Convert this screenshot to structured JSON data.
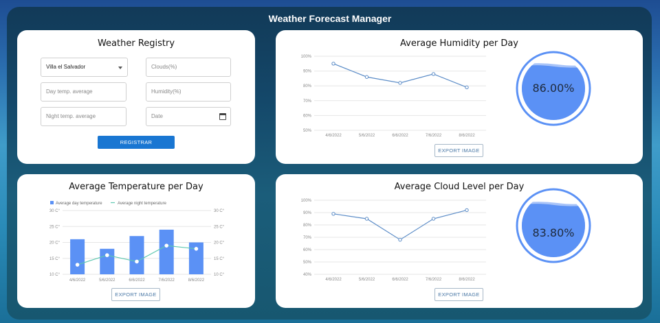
{
  "app": {
    "title": "Weather Forecast Manager"
  },
  "registry": {
    "title": "Weather Registry",
    "location_value": "Villa el Salvador",
    "clouds_placeholder": "Clouds(%)",
    "day_temp_placeholder": "Day temp. average",
    "humidity_placeholder": "Humidity(%)",
    "night_temp_placeholder": "Night temp. average",
    "date_placeholder": "Date",
    "submit_label": "REGISTRAR"
  },
  "humidity": {
    "title": "Average Humidity per Day",
    "export_label": "EXPORT IMAGE",
    "gauge_text": "86.00%",
    "gauge_value": 0.86
  },
  "temperature": {
    "title": "Average Temperature per Day",
    "export_label": "EXPORT IMAGE"
  },
  "clouds": {
    "title": "Average Cloud Level per Day",
    "export_label": "EXPORT IMAGE",
    "gauge_text": "83.80%",
    "gauge_value": 0.838
  },
  "colors": {
    "accent": "#1976d2",
    "line": "#5b8cc7",
    "bar": "#5b91f5",
    "night_line": "#5ec8b0",
    "gauge_fill": "#5b91f5"
  },
  "chart_data": [
    {
      "type": "line",
      "id": "humidity",
      "categories": [
        "4/6/2022",
        "5/6/2022",
        "6/6/2022",
        "7/6/2022",
        "8/6/2022"
      ],
      "values": [
        95,
        86,
        82,
        88,
        79
      ],
      "yticks": [
        "50%",
        "60%",
        "70%",
        "80%",
        "90%",
        "100%"
      ],
      "ylim": [
        50,
        100
      ],
      "grid": true
    },
    {
      "type": "bar",
      "id": "temperature",
      "categories": [
        "4/6/2022",
        "5/6/2022",
        "6/6/2022",
        "7/6/2022",
        "8/6/2022"
      ],
      "series": [
        {
          "name": "Average day temperature",
          "type": "bar",
          "values": [
            21,
            18,
            22,
            24,
            20
          ]
        },
        {
          "name": "Average night temperature",
          "type": "line",
          "values": [
            13,
            16,
            14,
            19,
            18
          ]
        }
      ],
      "yticks": [
        "10 C°",
        "15 C°",
        "20 C°",
        "25 C°",
        "30 C°"
      ],
      "ylim": [
        10,
        30
      ],
      "legend": "top-left",
      "grid": true
    },
    {
      "type": "line",
      "id": "clouds",
      "categories": [
        "4/6/2022",
        "5/6/2022",
        "6/6/2022",
        "7/6/2022",
        "8/6/2022"
      ],
      "values": [
        89,
        85,
        68,
        85,
        92
      ],
      "yticks": [
        "40%",
        "50%",
        "60%",
        "70%",
        "80%",
        "90%",
        "100%"
      ],
      "ylim": [
        40,
        100
      ],
      "grid": true
    }
  ]
}
